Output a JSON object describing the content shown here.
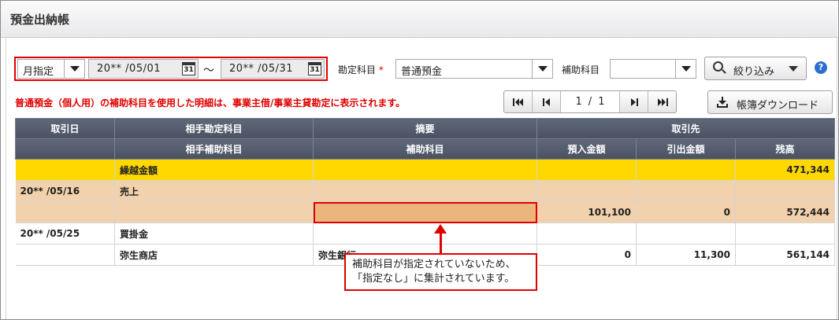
{
  "header": {
    "title": "預金出納帳"
  },
  "filters": {
    "period_mode": "月指定",
    "date_from": "20** /05/01",
    "date_to": "20** /05/31",
    "tilde": "～",
    "account_label": "勘定科目",
    "required_mark": "*",
    "account_value": "普通預金",
    "sub_account_label": "補助科目",
    "sub_account_value": "",
    "narrow_button": "絞り込み",
    "help_icon": "?"
  },
  "notice": "普通預金（個人用）の補助科目を使用した明細は、事業主借/事業主貸勘定に表示されます。",
  "pager": {
    "current": "1",
    "separator": "/",
    "total": "1"
  },
  "download_button": "帳簿ダウンロード",
  "table": {
    "header_row1": [
      "取引日",
      "相手勘定科目",
      "摘要",
      "取引先"
    ],
    "header_row2": [
      "",
      "相手補助科目",
      "補助科目",
      "預入金額",
      "引出金額",
      "残高"
    ],
    "rows": [
      {
        "type": "carry",
        "cells": [
          "",
          "繰越金額",
          "",
          "",
          "",
          "471,344"
        ]
      },
      {
        "type": "tan",
        "cells": [
          "20** /05/16",
          "売上",
          "",
          "",
          "",
          ""
        ]
      },
      {
        "type": "tan",
        "cells": [
          "",
          "",
          "",
          "101,100",
          "0",
          "572,444"
        ]
      },
      {
        "type": "white",
        "cells": [
          "20** /05/25",
          "買掛金",
          "",
          "",
          "",
          ""
        ]
      },
      {
        "type": "white",
        "cells": [
          "",
          "弥生商店",
          "弥生銀行",
          "0",
          "11,300",
          "561,144"
        ]
      }
    ]
  },
  "callout": {
    "line1": "補助科目が指定されていないため、",
    "line2": "「指定なし」に集計されています。"
  },
  "colors": {
    "accent_red": "#e00000",
    "carry_yellow": "#ffd800",
    "row_tan": "#f2d2ad",
    "header_slate": "#4a5262"
  }
}
